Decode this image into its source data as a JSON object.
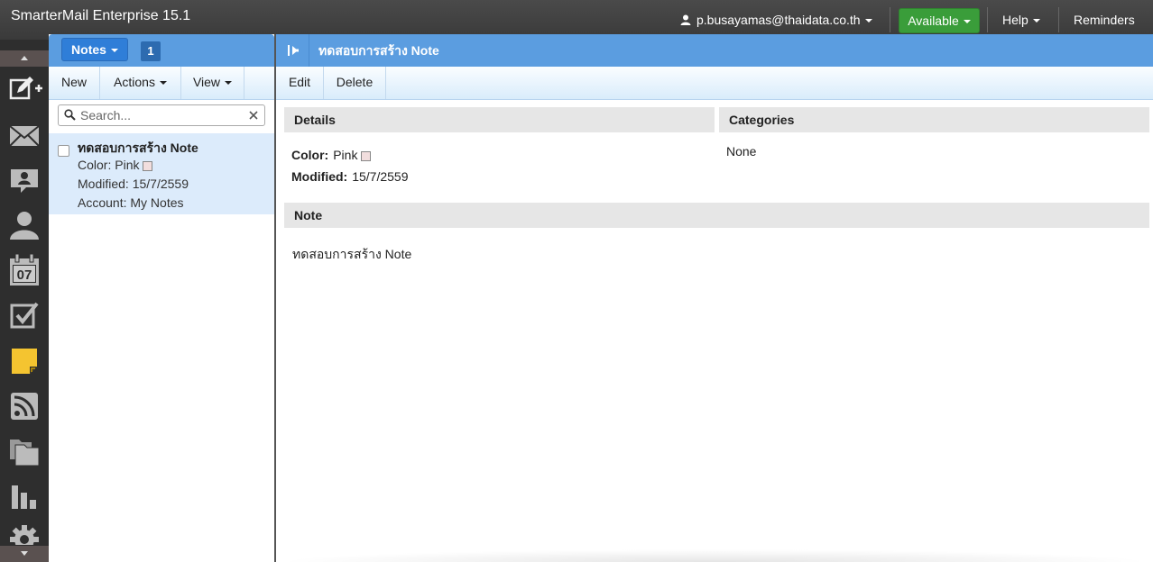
{
  "app": {
    "title": "SmarterMail Enterprise 15.1"
  },
  "topbar": {
    "user": "p.busayamas@thaidata.co.th",
    "status": "Available",
    "status_color": "#3a9d3a",
    "help": "Help",
    "reminders": "Reminders"
  },
  "nav": {
    "icons": [
      "compose-icon",
      "mail-icon",
      "chat-icon",
      "contacts-icon",
      "calendar-icon",
      "tasks-icon",
      "notes-icon",
      "rss-icon",
      "files-icon",
      "reports-icon",
      "settings-icon"
    ],
    "calendar_day": "07"
  },
  "list": {
    "folder_button": "Notes",
    "count": "1",
    "toolbar": {
      "new": "New",
      "actions": "Actions",
      "view": "View"
    },
    "search_placeholder": "Search...",
    "items": [
      {
        "title": "ทดสอบการสร้าง Note",
        "color_label": "Color:",
        "color_value": "Pink",
        "modified": "Modified: 15/7/2559",
        "account": "Account: My Notes"
      }
    ]
  },
  "main": {
    "title": "ทดสอบการสร้าง Note",
    "toolbar": {
      "edit": "Edit",
      "delete": "Delete"
    },
    "details": {
      "header": "Details",
      "color_label": "Color:",
      "color_value": "Pink",
      "modified_label": "Modified:",
      "modified_value": "15/7/2559"
    },
    "categories": {
      "header": "Categories",
      "value": "None"
    },
    "note": {
      "header": "Note",
      "body": "ทดสอบการสร้าง Note"
    }
  },
  "colors": {
    "header_blue": "#5b9de0",
    "accent_blue": "#2f7ed8",
    "topbar": "#3f3f3f"
  }
}
